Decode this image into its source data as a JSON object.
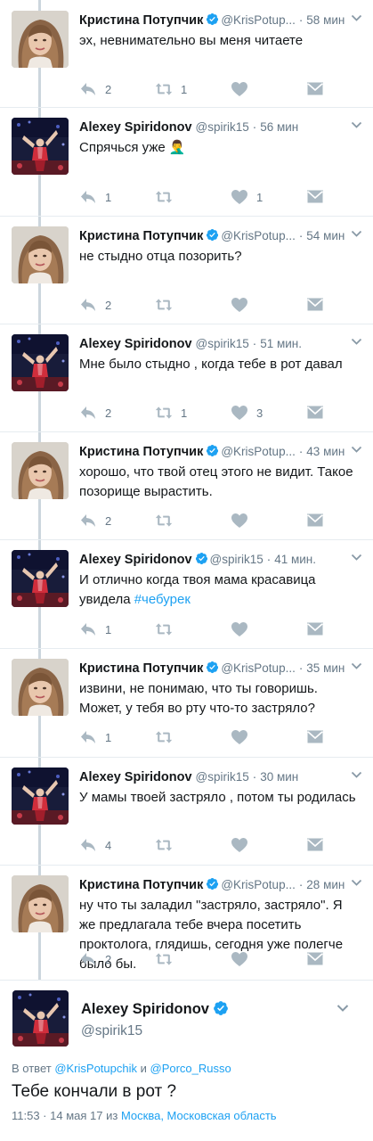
{
  "colors": {
    "accent": "#1da1f2",
    "verified": "#1da1f2",
    "muted": "#657786",
    "text": "#14171a",
    "line": "#ccd6dd"
  },
  "icons": {
    "reply": "reply-icon",
    "retweet": "retweet-icon",
    "like": "heart-icon",
    "dm": "envelope-icon",
    "verified": "verified-badge-icon",
    "menu": "chevron-down-icon"
  },
  "tweets": [
    {
      "name": "Кристина Потупчик",
      "verified": true,
      "handle": "@KrisPotup...",
      "sep": "·",
      "time": "58 мин",
      "text": "эх, невнимательно вы меня читаете",
      "reply_count": "2",
      "retweet_count": "1",
      "like_count": ""
    },
    {
      "name": "Alexey Spiridonov",
      "verified": false,
      "handle": "@spirik15",
      "sep": "·",
      "time": "56 мин",
      "text": "Спрячься уже 🤦‍♂️",
      "reply_count": "1",
      "retweet_count": "",
      "like_count": "1"
    },
    {
      "name": "Кристина Потупчик",
      "verified": true,
      "handle": "@KrisPotup...",
      "sep": "·",
      "time": "54 мин",
      "text": "не стыдно отца позорить?",
      "reply_count": "2",
      "retweet_count": "",
      "like_count": ""
    },
    {
      "name": "Alexey Spiridonov",
      "verified": false,
      "handle": "@spirik15",
      "sep": "·",
      "time": "51 мин.",
      "text": "Мне было стыдно , когда тебе в рот давал",
      "reply_count": "2",
      "retweet_count": "1",
      "like_count": "3"
    },
    {
      "name": "Кристина Потупчик",
      "verified": true,
      "handle": "@KrisPotup...",
      "sep": "·",
      "time": "43 мин",
      "text": "хорошо, что твой отец этого не видит. Такое позорище вырастить.",
      "reply_count": "2",
      "retweet_count": "",
      "like_count": ""
    },
    {
      "name": "Alexey Spiridonov",
      "verified": true,
      "handle": "@spirik15",
      "sep": "·",
      "time": "41 мин.",
      "text": "И отлично когда твоя мама красавица увидела ",
      "hashtag": "#чебурек",
      "reply_count": "1",
      "retweet_count": "",
      "like_count": ""
    },
    {
      "name": "Кристина Потупчик",
      "verified": true,
      "handle": "@KrisPotup...",
      "sep": "·",
      "time": "35 мин",
      "text": "извини, не понимаю, что ты говоришь. Может, у тебя во рту что-то застряло?",
      "reply_count": "1",
      "retweet_count": "",
      "like_count": ""
    },
    {
      "name": "Alexey Spiridonov",
      "verified": false,
      "handle": "@spirik15",
      "sep": "·",
      "time": "30 мин",
      "text": "У мамы твоей застряло , потом ты родилась",
      "reply_count": "4",
      "retweet_count": "",
      "like_count": ""
    },
    {
      "name": "Кристина Потупчик",
      "verified": true,
      "handle": "@KrisPotup...",
      "sep": "·",
      "time": "28 мин",
      "text": "ну что ты заладил \"застряло, застряло\". Я же предлагала тебе вчера посетить проктолога, глядишь, сегодня уже полегче было бы.",
      "reply_count": "2",
      "retweet_count": "",
      "like_count": ""
    }
  ],
  "main_tweet": {
    "name": "Alexey Spiridonov",
    "verified": true,
    "handle": "@spirik15",
    "reply_prefix": "В ответ ",
    "reply_user1": "@KrisPotupchik",
    "reply_and": " и ",
    "reply_user2": "@Porco_Russo",
    "text": "Тебе кончали в рот ?",
    "time": "11:53 · 14 мая 17",
    "from": " из ",
    "location": "Москва, Московская область"
  }
}
